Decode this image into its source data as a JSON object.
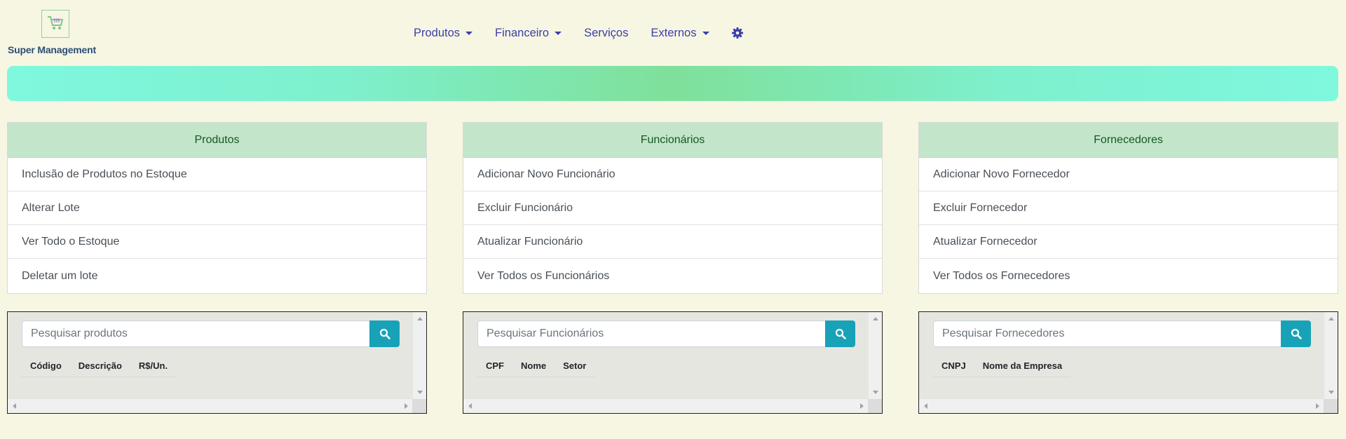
{
  "brand": {
    "name": "Super Management",
    "logo_icon": "shopping-cart-icon"
  },
  "nav": {
    "items": [
      {
        "label": "Produtos",
        "dropdown": true
      },
      {
        "label": "Financeiro",
        "dropdown": true
      },
      {
        "label": "Serviços",
        "dropdown": false
      },
      {
        "label": "Externos",
        "dropdown": true
      }
    ],
    "settings_icon": "gear-icon"
  },
  "colors": {
    "nav_link": "#3b3fa8",
    "card_header_bg": "#c3e6cb",
    "card_header_text": "#155724",
    "search_button": "#17a2b8",
    "background": "#f7f6e3"
  },
  "cards": [
    {
      "title": "Produtos",
      "items": [
        "Inclusão de Produtos no Estoque",
        "Alterar Lote",
        "Ver Todo o Estoque",
        "Deletar um lote"
      ]
    },
    {
      "title": "Funcionários",
      "items": [
        "Adicionar Novo Funcionário",
        "Excluir Funcionário",
        "Atualizar Funcionário",
        "Ver Todos os Funcionários"
      ]
    },
    {
      "title": "Fornecedores",
      "items": [
        "Adicionar Novo Fornecedor",
        "Excluir Fornecedor",
        "Atualizar Fornecedor",
        "Ver Todos os Fornecedores"
      ]
    }
  ],
  "searches": [
    {
      "placeholder": "Pesquisar produtos",
      "columns": [
        "Código",
        "Descrição",
        "R$/Un."
      ]
    },
    {
      "placeholder": "Pesquisar Funcionários",
      "columns": [
        "CPF",
        "Nome",
        "Setor"
      ]
    },
    {
      "placeholder": "Pesquisar Fornecedores",
      "columns": [
        "CNPJ",
        "Nome da Empresa"
      ]
    }
  ]
}
